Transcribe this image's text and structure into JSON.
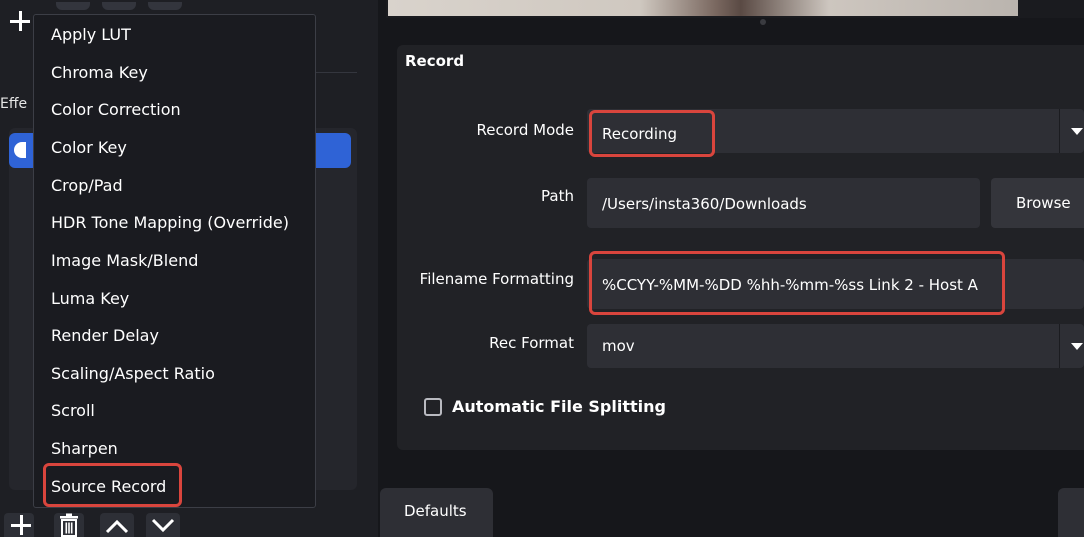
{
  "filter_menu": {
    "items": [
      "Apply LUT",
      "Chroma Key",
      "Color Correction",
      "Color Key",
      "Crop/Pad",
      "HDR Tone Mapping (Override)",
      "Image Mask/Blend",
      "Luma Key",
      "Render Delay",
      "Scaling/Aspect Ratio",
      "Scroll",
      "Sharpen",
      "Source Record"
    ],
    "highlighted_item": "Source Record"
  },
  "effects_panel": {
    "label": "Effe"
  },
  "filter_controls": {
    "icons": [
      "plus-icon",
      "trash-icon",
      "chevron-up-icon",
      "chevron-down-icon"
    ]
  },
  "record_settings": {
    "title": "Record",
    "record_mode": {
      "label": "Record Mode",
      "value": "Recording"
    },
    "path": {
      "label": "Path",
      "value": "/Users/insta360/Downloads",
      "browse_label": "Browse"
    },
    "filename_formatting": {
      "label": "Filename Formatting",
      "value": "%CCYY-%MM-%DD %hh-%mm-%ss Link 2 - Host A"
    },
    "rec_format": {
      "label": "Rec Format",
      "value": "mov"
    },
    "auto_split": {
      "label": "Automatic File Splitting",
      "checked": false
    }
  },
  "footer": {
    "defaults_label": "Defaults"
  },
  "colors": {
    "highlight_red": "#d9453d",
    "selection_blue": "#2f63d6",
    "panel_bg": "#212226"
  }
}
